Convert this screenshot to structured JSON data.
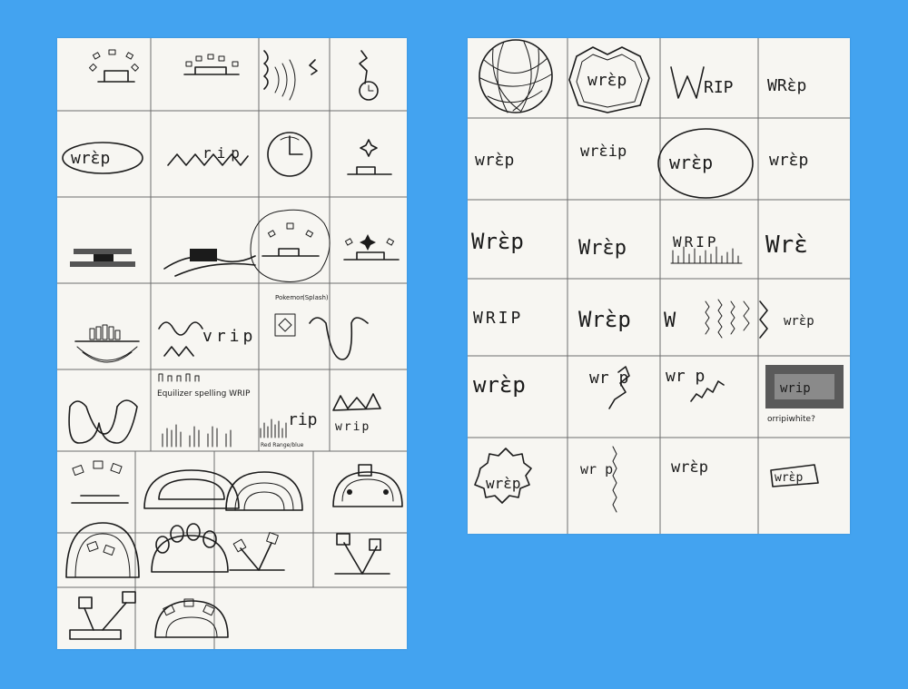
{
  "colors": {
    "background": "#43a3f0",
    "paper": "#f7f6f2",
    "ink": "#1b1b1b",
    "grid": "#6e6e6e"
  },
  "left_sheet": {
    "words": {
      "w1": "wrɛ̀p",
      "w2": "rip",
      "w3": "vrip",
      "w4": "rip",
      "w5": "wrip"
    },
    "notes": {
      "equalizer": "Equilizer spelling WRIP",
      "red_range": "Red Range/blue",
      "pokemon": "Pokemon",
      "splash": "(Splash)"
    }
  },
  "right_sheet": {
    "words": {
      "r1c2": "wrɛ̀p",
      "r1c3": "RIP",
      "r1c4": "WRɛ̀p",
      "r2c1": "wrɛ̀p",
      "r2c2": "wrɛ̀ip",
      "r2c3": "wrɛ̀p",
      "r2c4": "wrɛ̀p",
      "r3c1": "Wrɛ̀p",
      "r3c2": "Wrɛ̀p",
      "r3c3": "WRIP",
      "r3c4": "Wrɛ̀",
      "r4c1": "WRIP",
      "r4c2": "Wrɛ̀p",
      "r4c3": "W",
      "r4c4": "wrɛ̀p",
      "r5c1": "wrɛ̀p",
      "r5c2": "wr p",
      "r5c3": "wr p",
      "r5c4": "wrip",
      "r6c1": "wrɛ̀p",
      "r6c2": "wr p",
      "r6c3": "wrɛ̀p",
      "r6c4": "wrɛ̀p"
    },
    "notes": {
      "note": "orripiwhite?"
    }
  }
}
